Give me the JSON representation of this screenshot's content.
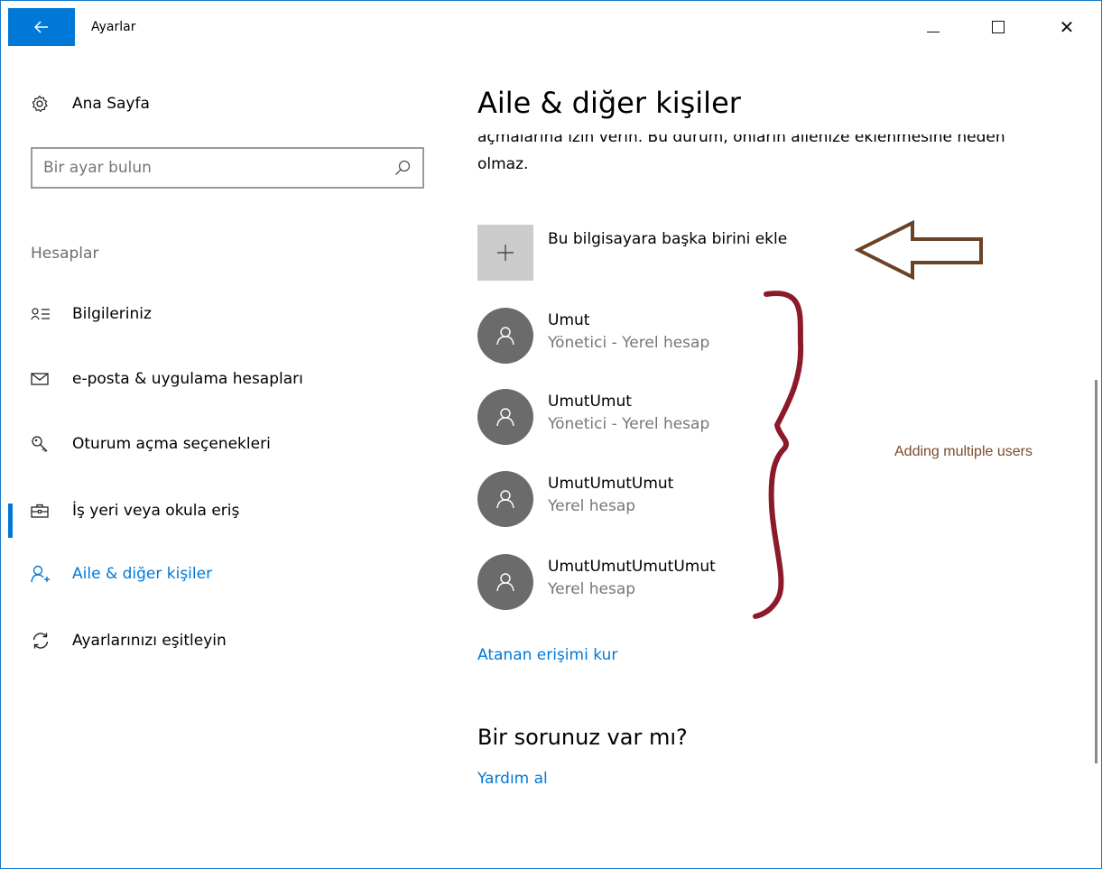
{
  "window": {
    "title": "Ayarlar",
    "back_icon": "back-arrow-icon",
    "controls": {
      "minimize": "minimize",
      "maximize": "maximize",
      "close": "✕"
    }
  },
  "sidebar": {
    "home_label": "Ana Sayfa",
    "search_placeholder": "Bir ayar bulun",
    "section_label": "Hesaplar",
    "items": [
      {
        "label": "Bilgileriniz",
        "icon": "person-list-icon"
      },
      {
        "label": "e-posta & uygulama hesapları",
        "icon": "mail-icon"
      },
      {
        "label": "Oturum açma seçenekleri",
        "icon": "key-icon"
      },
      {
        "label": "İş yeri veya okula eriş",
        "icon": "briefcase-icon"
      },
      {
        "label": "Aile & diğer kişiler",
        "icon": "add-person-icon",
        "active": true
      },
      {
        "label": "Ayarlarınızı eşitleyin",
        "icon": "sync-icon"
      }
    ]
  },
  "main": {
    "title": "Aile & diğer kişiler",
    "description": "açmalarına izin verin. Bu durum, onların ailenize eklenmesine neden olmaz.",
    "add_label": "Bu bilgisayara başka birini ekle",
    "users": [
      {
        "name": "Umut",
        "type": "Yönetici - Yerel hesap"
      },
      {
        "name": "UmutUmut",
        "type": "Yönetici - Yerel hesap"
      },
      {
        "name": "UmutUmutUmut",
        "type": "Yerel hesap"
      },
      {
        "name": "UmutUmutUmutUmut",
        "type": "Yerel hesap"
      }
    ],
    "assigned_access_link": "Atanan erişimi kur",
    "question_heading": "Bir sorunuz var mı?",
    "help_link": "Yardım al"
  },
  "annotation": {
    "text": "Adding multiple users",
    "color": "#7a4a2a",
    "brace_color": "#8b1a2b",
    "arrow_color": "#6b4226"
  },
  "colors": {
    "accent": "#0078d7",
    "avatar_bg": "#6b6b6b",
    "add_tile_bg": "#cccccc"
  }
}
